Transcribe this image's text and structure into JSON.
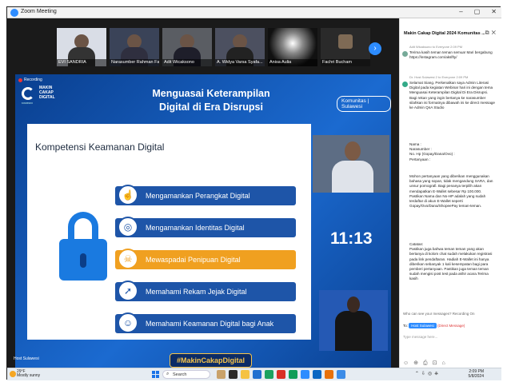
{
  "window": {
    "title": "Zoom Meeting",
    "controls": [
      "–",
      "▢",
      "✕"
    ]
  },
  "participants": [
    {
      "name": "EVI SANDRIA"
    },
    {
      "name": "Narasumber Rahman Faridh H..."
    },
    {
      "name": "Adit Wicaksono"
    },
    {
      "name": "A. Widya Varsa Syafa..."
    },
    {
      "name": "Anisa Aulia"
    },
    {
      "name": "Fachri Bucham"
    }
  ],
  "recording_label": "Recording",
  "slide": {
    "logo_text": "MAKIN CAKAP DIGITAL",
    "logo_sub": "KOMINFO",
    "title_line1": "Menguasai Keterampilan",
    "title_line2": "Digital di Era Disrupsi",
    "badge": "Komunitas | Sulawesi",
    "heading": "Kompetensi Keamanan Digital",
    "items": [
      {
        "label": "Mengamankan Perangkat Digital",
        "icon": "device-icon",
        "glyph": "☝"
      },
      {
        "label": "Mengamankan Identitas Digital",
        "icon": "fingerprint-icon",
        "glyph": "◎"
      },
      {
        "label": "Mewaspadai Penipuan Digital",
        "icon": "skull-icon",
        "glyph": "☠"
      },
      {
        "label": "Memahami Rekam Jejak Digital",
        "icon": "cursor-icon",
        "glyph": "➚"
      },
      {
        "label": "Memahami Keamanan Digital bagi Anak",
        "icon": "child-icon",
        "glyph": "☺"
      }
    ],
    "active_index": 2,
    "hashtag": "#MakinCakapDigital",
    "timer": "11:13"
  },
  "host_label": "Host Sulawesi",
  "chat": {
    "title": "Makin Cakap Digital 2024 Komunitas ...",
    "messages": [
      {
        "meta": "Adit Wicaksono to Everyone 2:09 PM",
        "text": "Terima kasih teman teman semua! Mari bergabung https://instagram.com/akslfty/"
      },
      {
        "meta": "Dr. Host Sulawesi 2 to Everyone 2:09 PM",
        "text": "Selamat Siang. Perkenalkan saya Admin Literasi Digital pada kegiatan Webinar hari ini dengan tema Menguasai Keterampilan Digital Di Era Disrupsi. Bagi rekan yang ingin bertanya ke narasumber silahkan isi formatnya dibawah ini ke direct message ke Admin QnA Studio"
      },
      {
        "text": "Nama :\nNarasumber :\nNo. Hp (Gopay/Dana/Ovo) :\nPertanyaan :"
      },
      {
        "text": "Mohon pertanyaan yang diberikan menggunakan bahasa yang sopan, tidak mengandung SARA, dan unsur pornografi. Bagi penanya terpilih akan mendapatkan E-Wallet sebesar Rp 100.000. Pastikan Nama dan No-HP adalah yang sudah terdaftar di akun E-Wallet seperti Gopay/Ovo/Dana/ShopeePay teman-teman."
      },
      {
        "text": "Catatan:\nPastikan juga bahwa teman teman yang akan bertanya di kolom chat sudah melakukan registrasi pada link pendaftaran. Hadiah E-Wallet ini hanya diberikan sebanyak 1 kali kesempatan bagi para pemberi pertanyaan. Pastikan juga teman teman sudah mengisi post test pada akhir acara.Terima kasih"
      }
    ],
    "who_can_see": "Who can see your messages? Recording On",
    "to_label": "To:",
    "to_value": "Host Sulawesi",
    "direct_label": "(Direct Message)",
    "placeholder": "Type message here..."
  },
  "taskbar": {
    "weather_temp": "29°F",
    "weather_desc": "Mostly sunny",
    "search": "Search",
    "time": "2:09 PM",
    "date": "5/8/2024"
  }
}
